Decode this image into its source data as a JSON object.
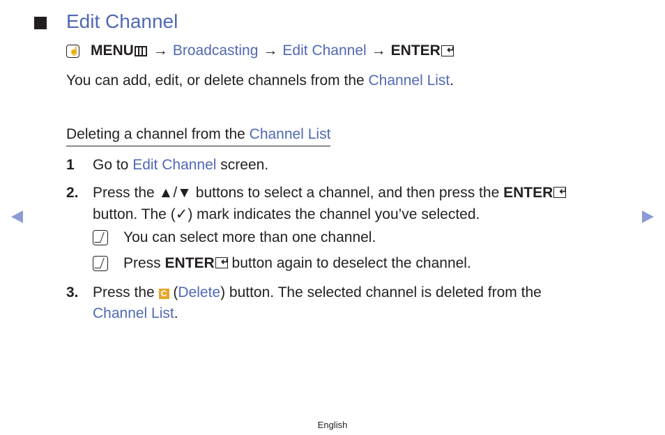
{
  "page": {
    "title": "Edit Channel",
    "path": {
      "menu_label": "MENU",
      "items": [
        "Broadcasting",
        "Edit Channel"
      ],
      "arrow": "→",
      "enter_label": "ENTER",
      "enter_glyph": "↵",
      "menu_badge_glyph": "☝"
    },
    "intro": {
      "prefix": "You can add, edit, or delete channels from the ",
      "link": "Channel List",
      "suffix": "."
    },
    "section": {
      "heading_prefix": "Deleting a channel from the ",
      "heading_link": "Channel List",
      "steps": [
        {
          "num": "1",
          "prefix": "Go to ",
          "link": "Edit Channel",
          "suffix": " screen."
        },
        {
          "num": "2.",
          "line1_prefix": "Press the ",
          "line1_arrows": "▲/▼",
          "line1_mid": " buttons to select a channel, and then press the ",
          "line1_enter": "ENTER",
          "line2_prefix": "button. The (",
          "check": "✓",
          "line2_suffix": ") mark indicates the channel you’ve selected.",
          "notes": [
            {
              "text": "You can select more than one channel."
            },
            {
              "prefix": "Press ",
              "enter": "ENTER",
              "suffix": " button again to deselect the channel."
            }
          ]
        },
        {
          "num": "3.",
          "prefix": "Press the ",
          "button_letter": "C",
          "open_paren": " (",
          "link": "Delete",
          "suffix": ") button. The selected channel is deleted from the",
          "line2_link": "Channel List",
          "line2_suffix": "."
        }
      ]
    },
    "navigation": {
      "prev": "previous-page",
      "next": "next-page"
    },
    "footer": {
      "language": "English"
    },
    "colors": {
      "link": "#5068b4",
      "text": "#231f20",
      "nav_arrow": "#8c9bd6",
      "c_button": "#e3a82b"
    }
  }
}
